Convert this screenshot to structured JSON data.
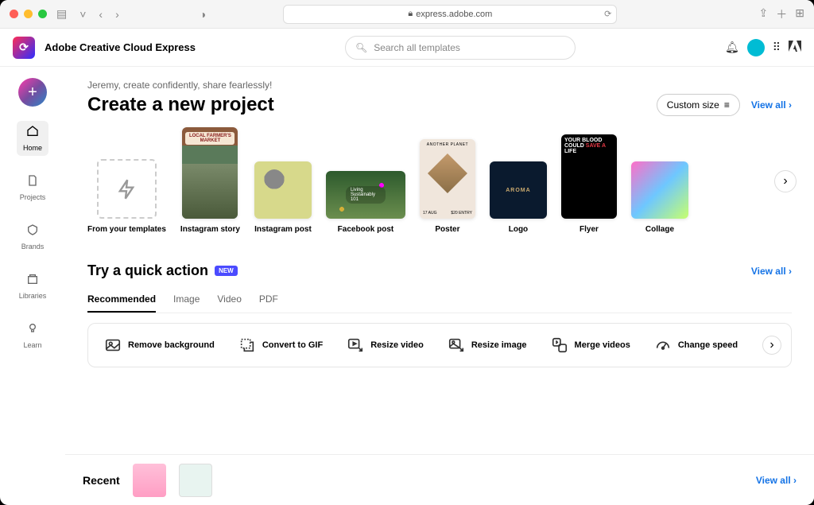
{
  "browser": {
    "url": "express.adobe.com",
    "lock_label": "lock"
  },
  "app": {
    "title": "Adobe Creative Cloud Express"
  },
  "search": {
    "placeholder": "Search all templates"
  },
  "sidebar": {
    "fab_label": "+",
    "items": [
      {
        "label": "Home",
        "icon": "⌂"
      },
      {
        "label": "Projects",
        "icon": "🗎"
      },
      {
        "label": "Brands",
        "icon": "🅱"
      },
      {
        "label": "Libraries",
        "icon": "🗂"
      },
      {
        "label": "Learn",
        "icon": "💡"
      }
    ]
  },
  "greeting": "Jeremy, create confidently, share fearlessly!",
  "create": {
    "heading": "Create a new project",
    "custom_size": "Custom size",
    "view_all": "View all",
    "items": [
      {
        "label": "From your templates"
      },
      {
        "label": "Instagram story"
      },
      {
        "label": "Instagram post"
      },
      {
        "label": "Facebook post"
      },
      {
        "label": "Poster"
      },
      {
        "label": "Logo"
      },
      {
        "label": "Flyer"
      },
      {
        "label": "Collage"
      }
    ],
    "logo_text": "AROMA",
    "flyer_text1": "YOUR BLOOD COULD",
    "flyer_text2": "SAVE A",
    "flyer_text3": "LIFE",
    "poster_date": "17 AUG",
    "poster_price": "$20 ENTRY"
  },
  "quick": {
    "heading": "Try a quick action",
    "badge": "NEW",
    "view_all": "View all",
    "tabs": [
      "Recommended",
      "Image",
      "Video",
      "PDF"
    ],
    "actions": [
      {
        "label": "Remove background"
      },
      {
        "label": "Convert to GIF"
      },
      {
        "label": "Resize video"
      },
      {
        "label": "Resize image"
      },
      {
        "label": "Merge videos"
      },
      {
        "label": "Change speed"
      }
    ]
  },
  "recent": {
    "heading": "Recent",
    "view_all": "View all"
  }
}
